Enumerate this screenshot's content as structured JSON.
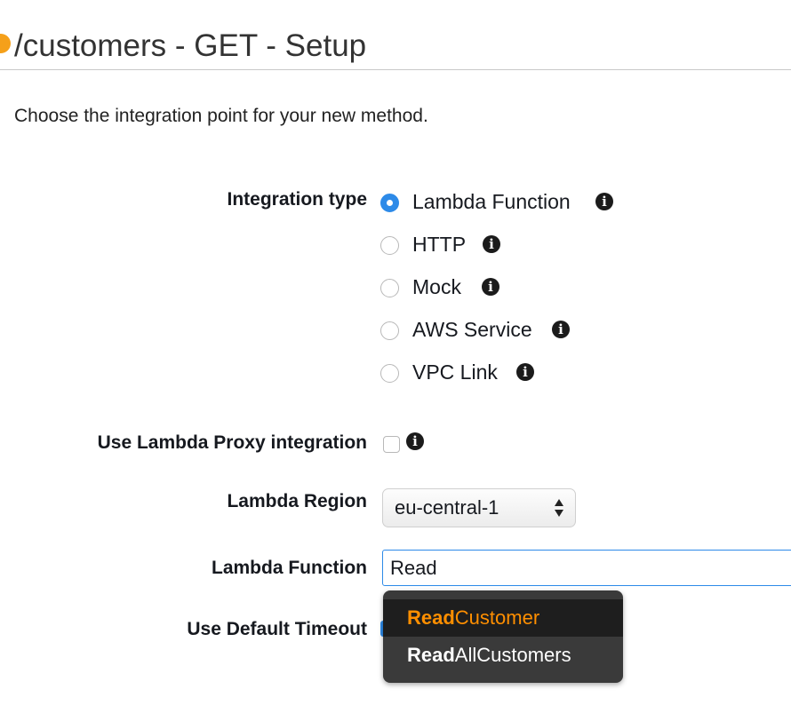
{
  "header": {
    "title": "/customers - GET - Setup",
    "status_color": "#f5a01a"
  },
  "intro": {
    "text": "Choose the integration point for your new method."
  },
  "integration_type": {
    "label": "Integration type",
    "selected": "Lambda Function",
    "options": [
      {
        "label": "Lambda Function",
        "checked": true
      },
      {
        "label": "HTTP",
        "checked": false
      },
      {
        "label": "Mock",
        "checked": false
      },
      {
        "label": "AWS Service",
        "checked": false
      },
      {
        "label": "VPC Link",
        "checked": false
      }
    ]
  },
  "proxy": {
    "label": "Use Lambda Proxy integration",
    "checked": false
  },
  "region": {
    "label": "Lambda Region",
    "value": "eu-central-1"
  },
  "function": {
    "label": "Lambda Function",
    "value": "Read"
  },
  "timeout": {
    "label": "Use Default Timeout",
    "checked": true
  },
  "suggestions": [
    {
      "match": "Read",
      "rest": "Customer",
      "active": true
    },
    {
      "match": "Read",
      "rest": "AllCustomers",
      "active": false
    }
  ],
  "colors": {
    "accent": "#2d8ae8",
    "suggest_highlight": "#ff8f00",
    "suggest_bg": "#3a3a3a"
  },
  "icons": {
    "info": "info-icon",
    "select_arrows": "up-down-arrows-icon"
  }
}
